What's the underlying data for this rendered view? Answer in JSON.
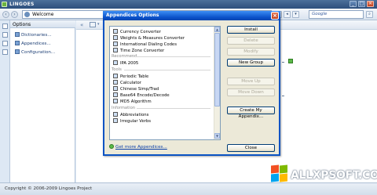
{
  "app": {
    "title": "LINGOES",
    "window_controls": [
      "_",
      "□",
      "×"
    ]
  },
  "toolbar": {
    "back_icon": "back-arrow-icon",
    "forward_icon": "forward-arrow-icon",
    "search_value": "Welcome",
    "google_placeholder": "Google"
  },
  "options_panel": {
    "title": "Options",
    "items": [
      {
        "label": "Dictionaries..."
      },
      {
        "label": "Appendices..."
      },
      {
        "label": "Configuration..."
      }
    ]
  },
  "dialog": {
    "title": "Appendices Options",
    "close_label": "×",
    "sections": [
      {
        "header": "",
        "items": [
          "Currency Converter",
          "Weights & Measures Converter",
          "International Dialing Codes",
          "Time Zone Converter"
        ]
      },
      {
        "header": "Recommend",
        "items": [
          "IPA 2005"
        ]
      },
      {
        "header": "Tools",
        "items": [
          "Periodic Table",
          "Calculator",
          "Chinese Simp/Trad",
          "Base64 Encode/Decode",
          "MD5 Algorithm"
        ]
      },
      {
        "header": "Information",
        "items": [
          "Abbreviations",
          "Irregular Verbs"
        ]
      }
    ],
    "buttons": {
      "install": "Install",
      "delete": "Delete",
      "modify": "Modify",
      "new_group": "New Group",
      "move_up": "Move Up",
      "move_down": "Move Down",
      "create": "Create My Appendix...",
      "close": "Close"
    },
    "get_more": "Get more Appendices..."
  },
  "status": {
    "copyright": "Copyright © 2006-2009 Lingoes Project"
  },
  "watermark": {
    "text": "ALLXPSOFT.COM"
  },
  "colors": {
    "title_blue": "#0a50c8",
    "dialog_bg": "#ece9d8",
    "accent_green": "#5cb848"
  }
}
